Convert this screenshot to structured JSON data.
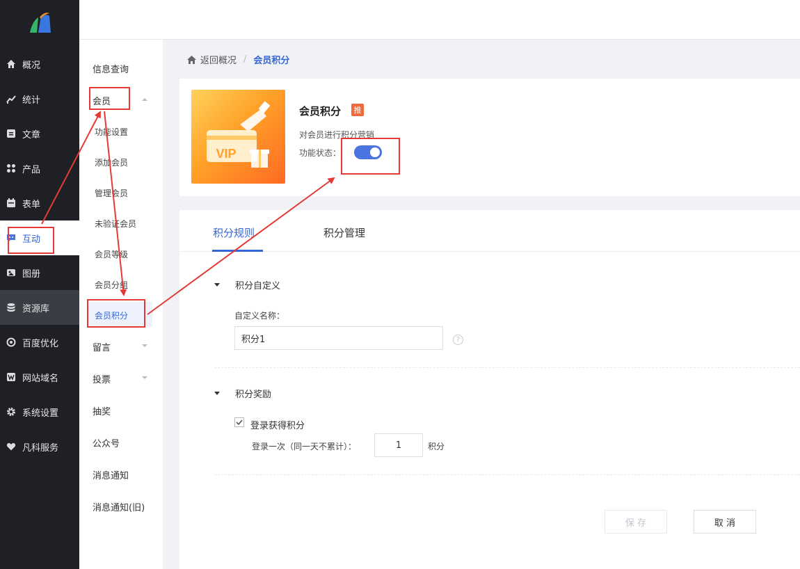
{
  "nav": {
    "items": [
      {
        "label": "概况",
        "icon": "home-icon"
      },
      {
        "label": "统计",
        "icon": "chart-icon"
      },
      {
        "label": "文章",
        "icon": "article-icon"
      },
      {
        "label": "产品",
        "icon": "grid-icon"
      },
      {
        "label": "表单",
        "icon": "calendar-icon"
      },
      {
        "label": "互动",
        "icon": "chat-icon"
      },
      {
        "label": "图册",
        "icon": "album-icon"
      },
      {
        "label": "资源库",
        "icon": "database-icon"
      },
      {
        "label": "百度优化",
        "icon": "target-icon"
      },
      {
        "label": "网站域名",
        "icon": "w-icon"
      },
      {
        "label": "系统设置",
        "icon": "gear-icon"
      },
      {
        "label": "凡科服务",
        "icon": "heart-icon"
      }
    ]
  },
  "sub": {
    "info": "信息查询",
    "member": "会员",
    "children": [
      "功能设置",
      "添加会员",
      "管理会员",
      "未验证会员",
      "会员等级",
      "会员分组",
      "会员积分"
    ],
    "message": "留言",
    "vote": "投票",
    "lottery": "抽奖",
    "official": "公众号",
    "notice": "消息通知",
    "notice_old": "消息通知(旧)"
  },
  "breadcrumb": {
    "back": "返回概况",
    "sep": "/",
    "current": "会员积分"
  },
  "feature": {
    "title": "会员积分",
    "badge": "推",
    "desc": "对会员进行积分营销",
    "status_label": "功能状态：",
    "vip": "VIP",
    "enabled": true
  },
  "tabs": [
    "积分规则",
    "积分管理"
  ],
  "section1": {
    "title": "积分自定义",
    "name_label": "自定义名称：",
    "name_value": "积分1",
    "help": "?"
  },
  "section2": {
    "title": "积分奖励",
    "checkbox_label": "登录获得积分",
    "checked": true,
    "rule_label": "登录一次（同一天不累计）：",
    "rule_value": "1",
    "unit": "积分"
  },
  "buttons": {
    "save": "保 存",
    "cancel": "取 消"
  },
  "colors": {
    "primary": "#3566d8",
    "annotation": "#e53935",
    "sidebar": "#1e2026"
  }
}
